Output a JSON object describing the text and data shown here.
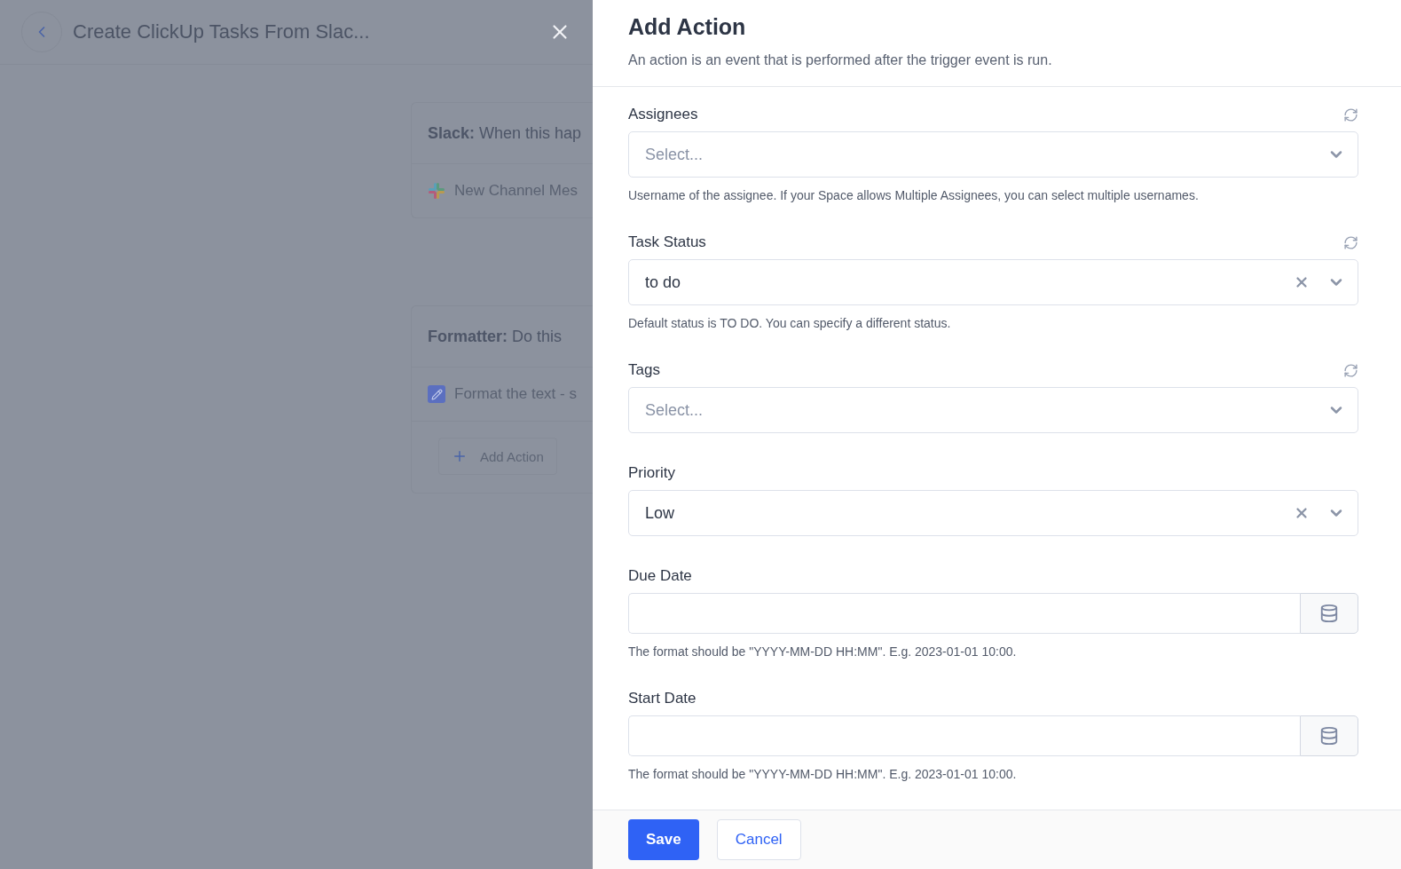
{
  "background": {
    "title": "Create ClickUp Tasks From Slac...",
    "cards": [
      {
        "app": "Slack:",
        "subtitle": "When this hap",
        "steps": [
          {
            "kind": "slack",
            "text": "New Channel Mes"
          }
        ]
      },
      {
        "app": "Formatter:",
        "subtitle": "Do this",
        "steps": [
          {
            "kind": "formatter",
            "text": "Format the text - s"
          }
        ],
        "add_button": "Add Action"
      }
    ]
  },
  "panel": {
    "title": "Add Action",
    "description": "An action is an event that is performed after the trigger event is run.",
    "fields": [
      {
        "kind": "select",
        "label": "Assignees",
        "refresh": true,
        "placeholder": "Select...",
        "clearable": false,
        "hint": "Username of the assignee. If your Space allows Multiple Assignees, you can select multiple usernames."
      },
      {
        "kind": "select",
        "label": "Task Status",
        "refresh": true,
        "value": "to do",
        "clearable": true,
        "hint": "Default status is TO DO. You can specify a different status."
      },
      {
        "kind": "select",
        "label": "Tags",
        "refresh": true,
        "placeholder": "Select...",
        "clearable": false
      },
      {
        "kind": "select",
        "label": "Priority",
        "refresh": false,
        "value": "Low",
        "clearable": true
      },
      {
        "kind": "date",
        "label": "Due Date",
        "hint": "The format should be \"YYYY-MM-DD HH:MM\". E.g. 2023-01-01 10:00."
      },
      {
        "kind": "date",
        "label": "Start Date",
        "hint": "The format should be \"YYYY-MM-DD HH:MM\". E.g. 2023-01-01 10:00."
      }
    ],
    "save": "Save",
    "cancel": "Cancel"
  }
}
